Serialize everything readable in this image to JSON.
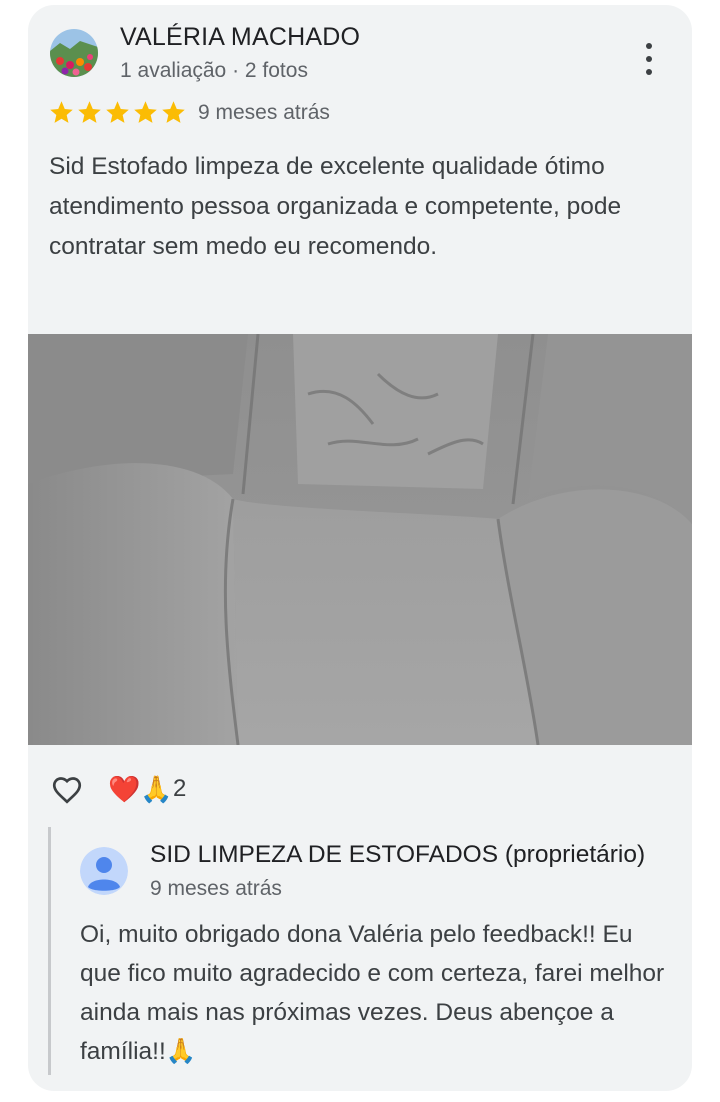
{
  "reviewer": {
    "name": "VALÉRIA MACHADO",
    "meta": "1 avaliação · 2 fotos"
  },
  "review": {
    "rating": 5,
    "time": "9 meses atrás",
    "text": "Sid Estofado limpeza de excelente qualidade ótimo atendimento pessoa organizada e competente, pode contratar sem medo eu recomendo."
  },
  "reactions": {
    "emojis": "❤️🙏",
    "count": "2"
  },
  "owner_reply": {
    "name": "SID LIMPEZA DE ESTOFADOS (proprietário)",
    "time": "9 meses atrás",
    "text": "Oi, muito obrigado dona Valéria pelo feedback!! Eu que fico muito agradecido e com certeza, farei melhor ainda mais nas próximas vezes. Deus abençoe a família!!🙏"
  },
  "icons": {
    "menu": "more-vert-icon",
    "like": "heart-outline-icon",
    "star": "star-icon",
    "owner_avatar": "person-avatar-icon"
  },
  "colors": {
    "card_bg": "#f1f3f4",
    "star": "#fbbc04",
    "text": "#3c4043",
    "secondary": "#5f6368",
    "owner_avatar_bg": "#c2d7fb",
    "owner_avatar_fg": "#4f86ec"
  }
}
